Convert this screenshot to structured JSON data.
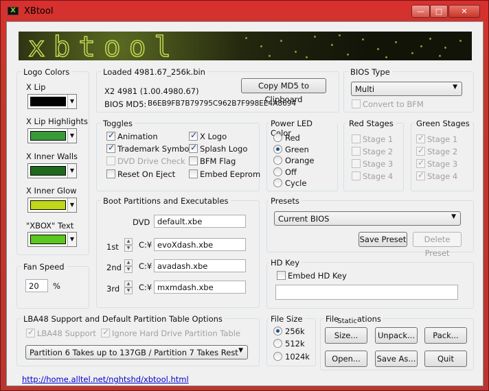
{
  "window": {
    "title": "XBtool",
    "icon_glyph": "X",
    "minimize": "—",
    "maximize": "□",
    "close": "✕"
  },
  "banner": {
    "text": "xbtool"
  },
  "logo_colors": {
    "title": "Logo Colors",
    "items": [
      {
        "label": "X Lip",
        "color": "#000000"
      },
      {
        "label": "X Lip Highlights",
        "color": "#3a9a3a"
      },
      {
        "label": "X Inner Walls",
        "color": "#1e6a1e"
      },
      {
        "label": "X Inner Glow",
        "color": "#c0d818"
      },
      {
        "label": "\"XBOX\" Text",
        "color": "#5ac81e"
      }
    ],
    "arrow": "▼"
  },
  "bios_info": {
    "loaded": "Loaded 4981.67_256k.bin",
    "copy_button": "Copy MD5 to Clipboard",
    "version_line": "X2 4981 (1.00.4980.67)",
    "md5_label": "BIOS MD5:",
    "md5_value": "B6EB9FB7B79795C962B7F998EE4A8694"
  },
  "bios_type": {
    "title": "BIOS Type",
    "selected": "Multi",
    "convert_label": "Convert to BFM"
  },
  "toggles": {
    "title": "Toggles",
    "items": [
      {
        "label": "Animation",
        "checked": true,
        "enabled": true
      },
      {
        "label": "X Logo",
        "checked": true,
        "enabled": true
      },
      {
        "label": "Trademark Symbol",
        "checked": true,
        "enabled": true
      },
      {
        "label": "Splash Logo",
        "checked": true,
        "enabled": true
      },
      {
        "label": "DVD Drive Check",
        "checked": false,
        "enabled": false
      },
      {
        "label": "BFM Flag",
        "checked": false,
        "enabled": true
      },
      {
        "label": "Reset On Eject",
        "checked": false,
        "enabled": true
      },
      {
        "label": "Embed Eeprom",
        "checked": false,
        "enabled": true
      }
    ]
  },
  "power_led": {
    "title": "Power LED Color",
    "options": [
      "Red",
      "Green",
      "Orange",
      "Off",
      "Cycle"
    ],
    "selected": "Green"
  },
  "red_stages": {
    "title": "Red Stages",
    "items": [
      "Stage 1",
      "Stage 2",
      "Stage 3",
      "Stage 4"
    ]
  },
  "green_stages": {
    "title": "Green Stages",
    "items": [
      "Stage 1",
      "Stage 2",
      "Stage 3",
      "Stage 4"
    ]
  },
  "boot": {
    "title": "Boot Partitions and Executables",
    "dvd_label": "DVD",
    "dvd_value": "default.xbe",
    "rows": [
      {
        "label": "1st",
        "drive": "C:¥",
        "value": "evoXdash.xbe"
      },
      {
        "label": "2nd",
        "drive": "C:¥",
        "value": "avadash.xbe"
      },
      {
        "label": "3rd",
        "drive": "C:¥",
        "value": "mxmdash.xbe"
      }
    ]
  },
  "presets": {
    "title": "Presets",
    "selected": "Current BIOS",
    "save": "Save Preset",
    "delete": "Delete Preset"
  },
  "hd_key": {
    "title": "HD Key",
    "embed_label": "Embed HD Key",
    "value": ""
  },
  "fan_speed": {
    "title": "Fan Speed",
    "value": "20",
    "unit": "%"
  },
  "lba48": {
    "title": "LBA48 Support and Default Partition Table Options",
    "support_label": "LBA48 Support",
    "ignore_label": "Ignore Hard Drive Partition Table",
    "selected": "Partition 6 Takes up to 137GB / Partition 7 Takes Rest"
  },
  "file_size": {
    "title": "File Size",
    "options": [
      "256k",
      "512k",
      "1024k"
    ],
    "selected": "256k"
  },
  "file_ops": {
    "title": "File",
    "overlay": "Static",
    "title_tail": "ations",
    "buttons": [
      "Size...",
      "Unpack...",
      "Pack...",
      "Open...",
      "Save As...",
      "Quit"
    ]
  },
  "link": {
    "text": "http://home.alltel.net/nghtshd/xbtool.html"
  }
}
